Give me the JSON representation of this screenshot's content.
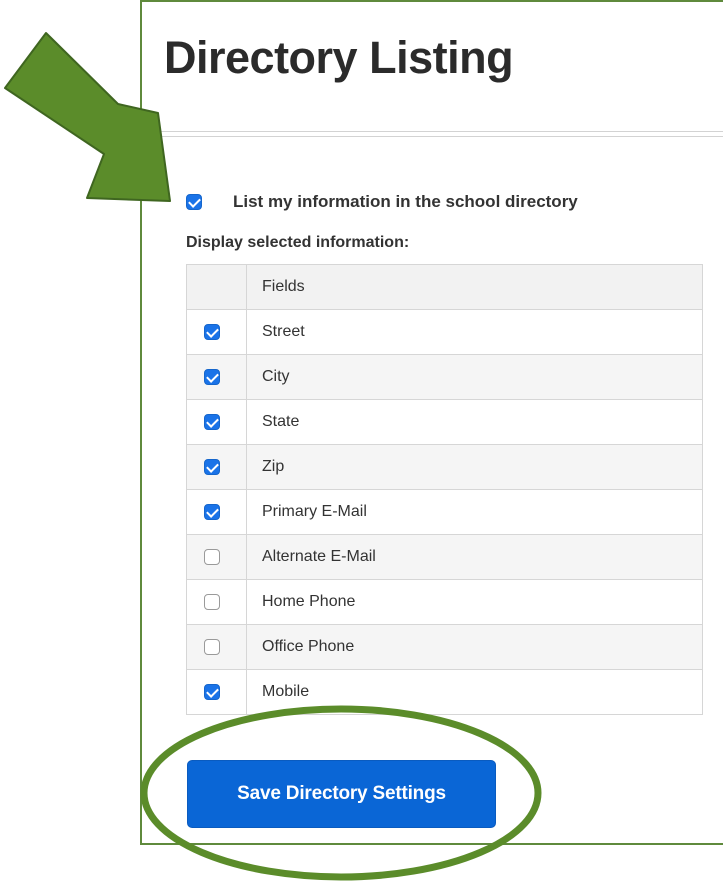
{
  "page": {
    "title": "Directory Listing"
  },
  "directory": {
    "master_label": "List my information in the school directory",
    "master_checked": true,
    "subheading": "Display selected information:",
    "table_header": "Fields",
    "fields": [
      {
        "label": "Street",
        "checked": true
      },
      {
        "label": "City",
        "checked": true
      },
      {
        "label": "State",
        "checked": true
      },
      {
        "label": "Zip",
        "checked": true
      },
      {
        "label": "Primary E-Mail",
        "checked": true
      },
      {
        "label": "Alternate E-Mail",
        "checked": false
      },
      {
        "label": "Home Phone",
        "checked": false
      },
      {
        "label": "Office Phone",
        "checked": false
      },
      {
        "label": "Mobile",
        "checked": true
      }
    ],
    "save_label": "Save Directory Settings"
  },
  "annotations": {
    "arrow_icon": "arrow-pointer",
    "ellipse_icon": "highlight-ellipse",
    "color": "#5b8c2a"
  },
  "colors": {
    "accent": "#1a73e8",
    "button": "#0a66d6",
    "panel_border": "#5f8a3c"
  }
}
